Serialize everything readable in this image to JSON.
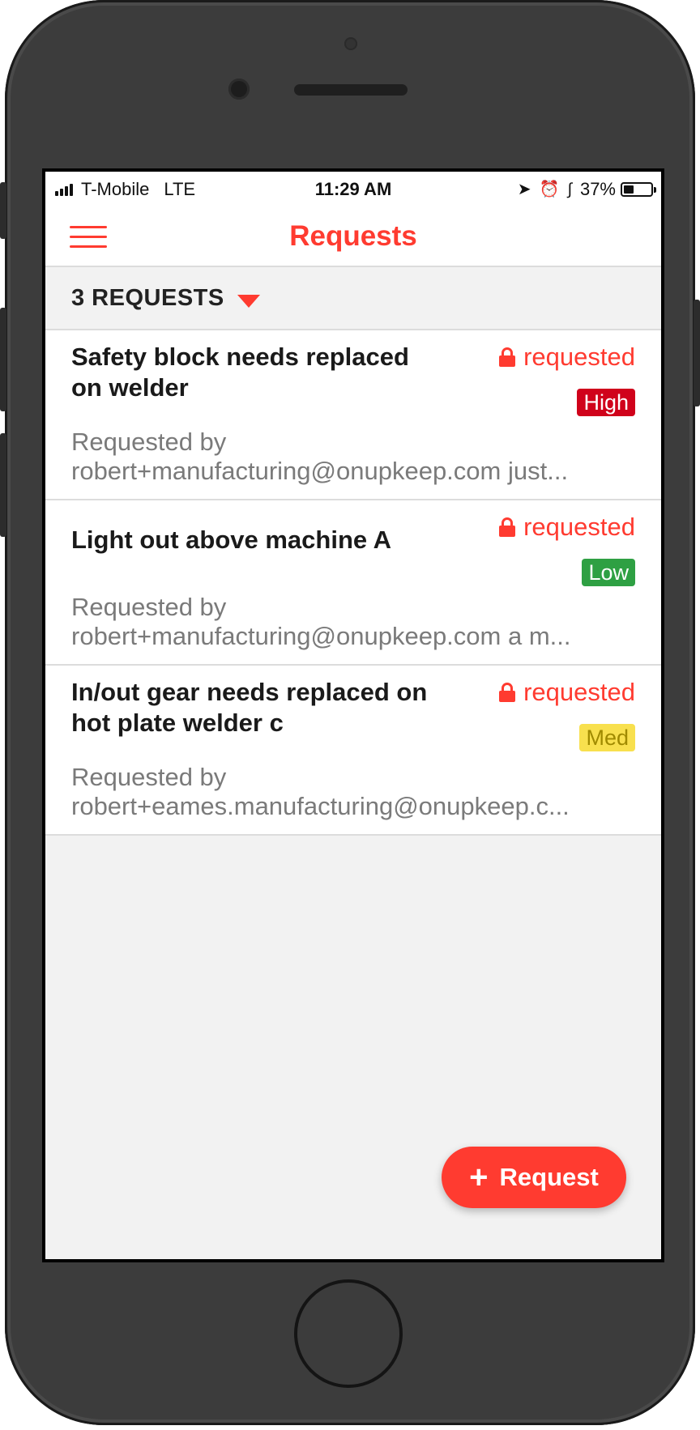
{
  "status_bar": {
    "carrier": "T-Mobile",
    "network": "LTE",
    "time": "11:29 AM",
    "battery_percent": "37%",
    "battery_level": 0.37,
    "icons": [
      "location-arrow-icon",
      "alarm-icon",
      "bluetooth-icon",
      "battery-icon"
    ]
  },
  "nav": {
    "title": "Requests",
    "menu_icon": "hamburger-menu-icon"
  },
  "filter": {
    "label": "3 REQUESTS",
    "icon": "caret-down-icon"
  },
  "requests": [
    {
      "title": "Safety block needs replaced on welder",
      "status": "requested",
      "priority": "High",
      "requested_by_label": "Requested by",
      "requester_line": "robert+manufacturing@onupkeep.com just..."
    },
    {
      "title": "Light out above machine A",
      "status": "requested",
      "priority": "Low",
      "requested_by_label": "Requested by",
      "requester_line": "robert+manufacturing@onupkeep.com a m..."
    },
    {
      "title": "In/out gear needs replaced on hot plate welder c",
      "status": "requested",
      "priority": "Med",
      "requested_by_label": "Requested by",
      "requester_line": "robert+eames.manufacturing@onupkeep.c..."
    }
  ],
  "fab": {
    "plus": "+",
    "label": "Request"
  },
  "colors": {
    "accent": "#ff3b30",
    "priority_high_bg": "#d0021b",
    "priority_high_fg": "#ffffff",
    "priority_low_bg": "#2ea043",
    "priority_low_fg": "#ffffff",
    "priority_med_bg": "#f8e04e",
    "priority_med_fg": "#a08a00"
  }
}
